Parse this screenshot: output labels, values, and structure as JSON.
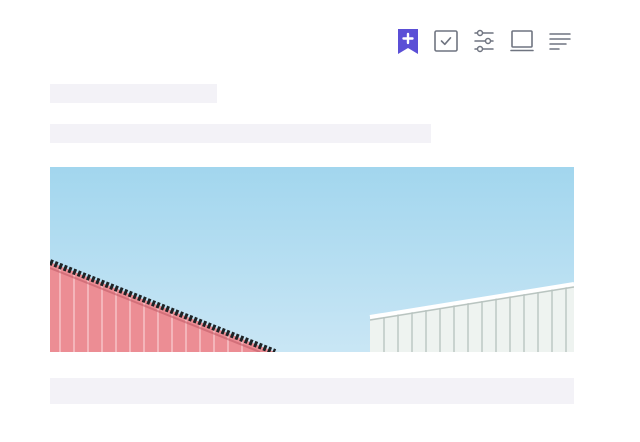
{
  "colors": {
    "accent": "#5b4fd6",
    "icon_gray": "#6f7480",
    "skeleton": "#f3f2f7",
    "sky": "#9fd3ec",
    "red_wall": "#ec8d94",
    "white_wall": "#eef3f0"
  },
  "toolbar": {
    "icons": [
      "bookmark-add-icon",
      "checkbox-icon",
      "sliders-icon",
      "monitor-icon",
      "align-left-icon"
    ]
  },
  "skeletons": [
    "title",
    "subtitle",
    "footer"
  ]
}
